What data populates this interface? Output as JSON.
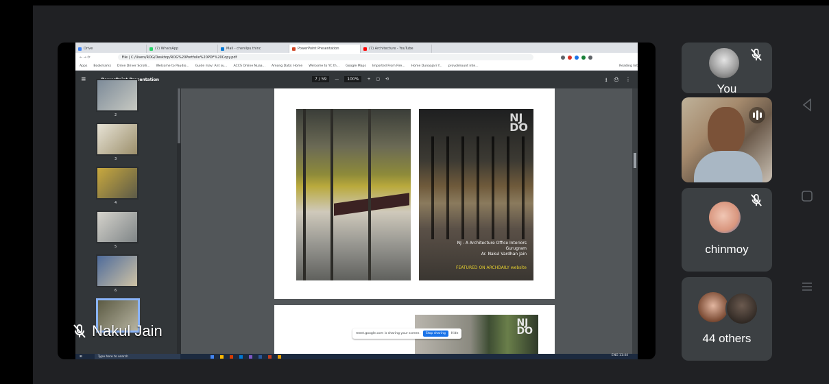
{
  "browser": {
    "tabs": [
      {
        "label": "Drive",
        "color": "#4285f4"
      },
      {
        "label": "(7) WhatsApp",
        "color": "#25d366"
      },
      {
        "label": "Mail - chenilpu.thinc",
        "color": "#0078d4"
      },
      {
        "label": "PowerPoint Presentation",
        "color": "#d04423",
        "active": true
      },
      {
        "label": "(7) Architecture - YouTube",
        "color": "#ff0000"
      }
    ],
    "address": "File | C:/Users/ROG/Desktop/ROG%20Portfolio%20PDF%20Copy.pdf",
    "bookmarks": [
      "Apps",
      "Bookmarks",
      "Drive Driver Scrolli...",
      "Welcome to Paudio...",
      "Guide mav: Ant su...",
      "ACCS Online Nuaa...",
      "Among Data: Home",
      "Welcome to YC th...",
      "Google Maps",
      "Imported From Fire...",
      "Home Dunaajari Y...",
      "provolmount inte..."
    ],
    "reading_list": "Reading list"
  },
  "pdf": {
    "title": "PowerPoint Presentation",
    "page_indicator": "7 / 59",
    "zoom": "100%",
    "page_numbers": [
      "2",
      "3",
      "4",
      "5",
      "6",
      "7"
    ],
    "logo": "NJ\nDO",
    "caption_line1": "NJ - A Architecture Office Interiors",
    "caption_line2": "Gurugram",
    "caption_line3": "Ar. Nakul Vardhan Jain",
    "featured": "FEATURED ON ARCHDAILY website"
  },
  "share_bar": {
    "message": "meet.google.com is sharing your screen.",
    "stop": "Stop sharing",
    "hide": "Hide"
  },
  "taskbar": {
    "search_placeholder": "Type here to search",
    "clock": "ENG 11:44"
  },
  "presenter": {
    "name": "Nakul Jain",
    "muted": true
  },
  "participants": {
    "you_label": "You",
    "chinmoy_label": "chinmoy",
    "others_label": "44 others"
  },
  "icons": {
    "mic_off": "mic-off-icon",
    "speaking": "speaking-indicator-icon",
    "nav_back": "back-triangle-icon",
    "nav_home": "home-square-icon",
    "nav_menu": "menu-lines-icon"
  }
}
